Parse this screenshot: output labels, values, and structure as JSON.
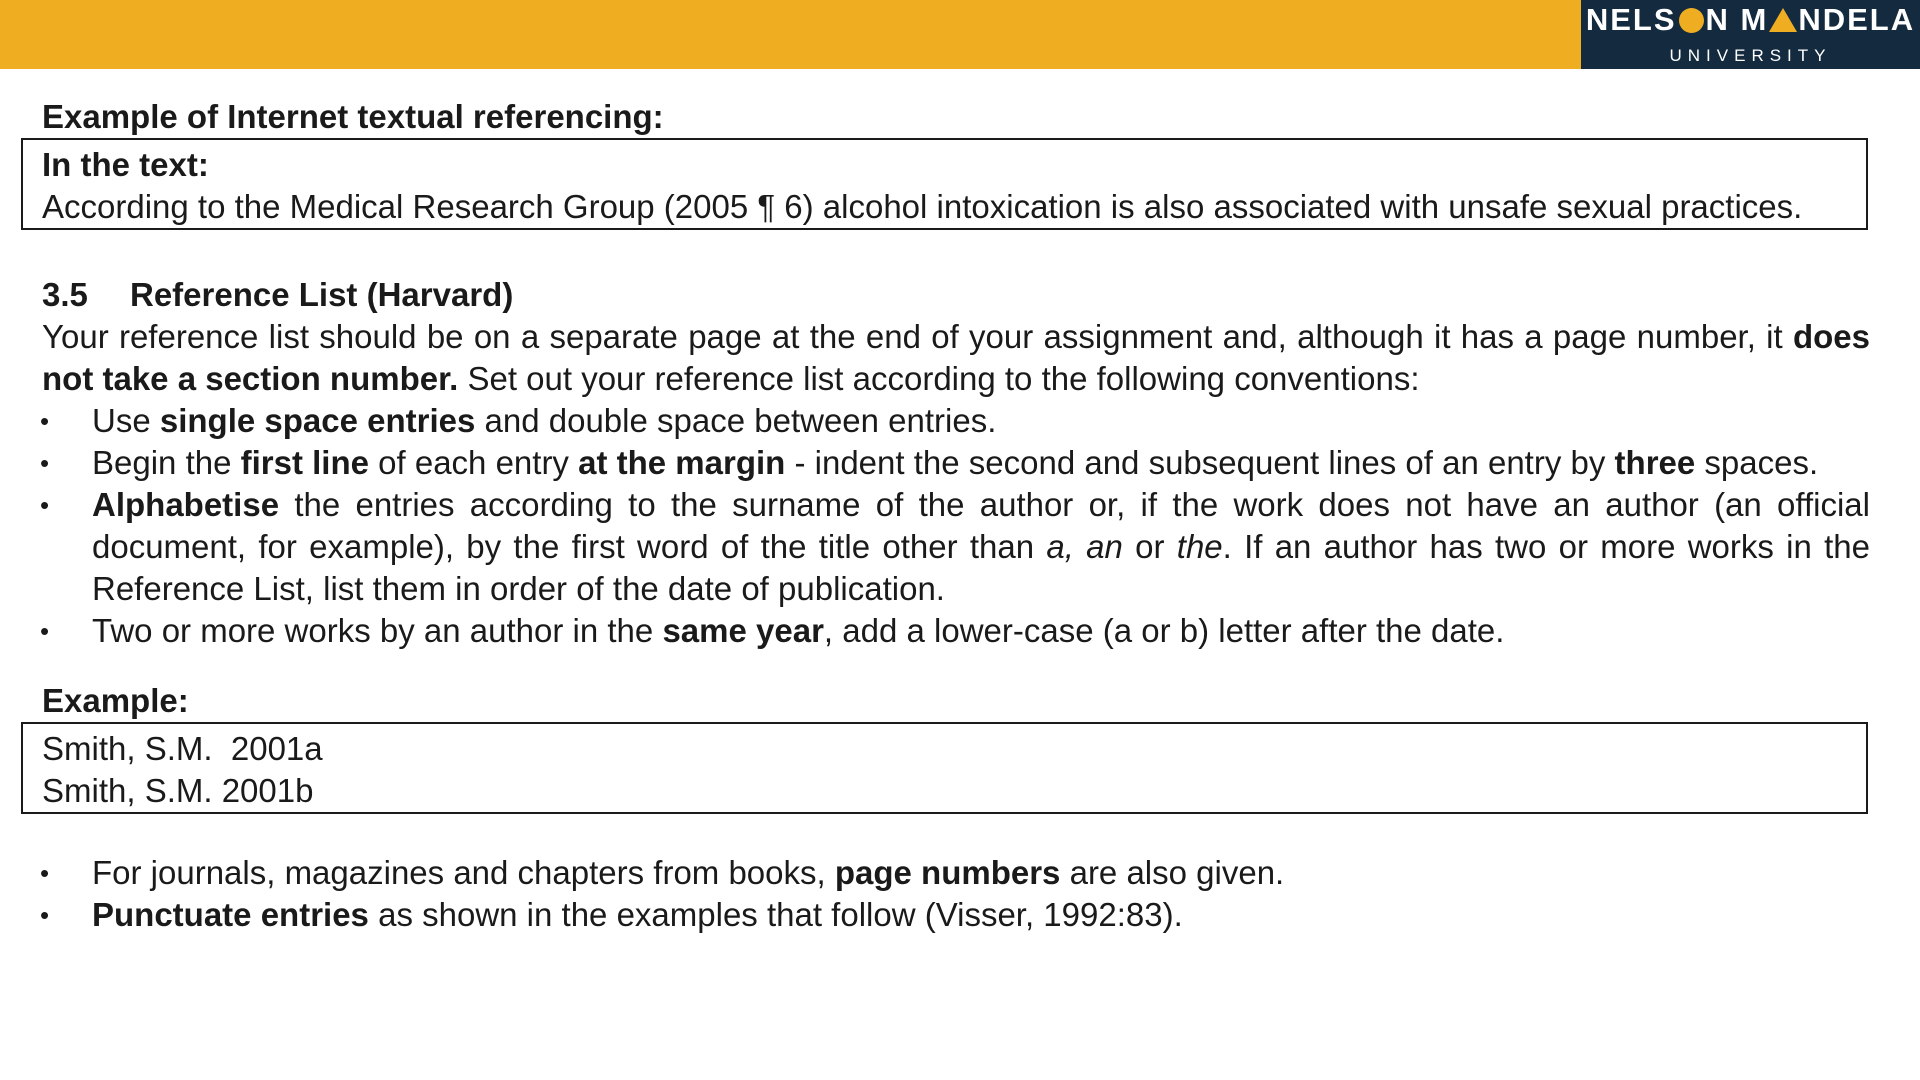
{
  "logo": {
    "name_part1": "NELS",
    "name_part2": "N  M",
    "name_part3": "NDELA",
    "subtitle": "UNIVERSITY"
  },
  "example_internet": {
    "heading": "Example of Internet textual referencing:",
    "box_label": "In the text:",
    "box_text": "According to the Medical Research Group (2005 ¶ 6) alcohol intoxication is also associated with unsafe sexual practices."
  },
  "section": {
    "number": "3.5",
    "title": "Reference List (Harvard)",
    "intro_a": "Your reference list should be on a separate page at the end of your assignment and, although it has a page number, it ",
    "intro_b": "does not take a section number.",
    "intro_c": "  Set out your reference list according to the following conventions:"
  },
  "bullets": [
    {
      "p1": "Use ",
      "b1": "single space entries",
      "p2": " and double space between entries."
    },
    {
      "p1": "Begin the ",
      "b1": "first line",
      "p2": " of each entry ",
      "b2": "at the margin",
      "p3": " - indent the second and subsequent lines of an entry by ",
      "b3": "three",
      "p4": " spaces."
    },
    {
      "b1": "Alphabetise",
      "p1": " the entries according to the surname of the author or, if the work does not have an author (an official document, for example), by the first word of the title other than ",
      "i1": "a, an",
      "p2": " or ",
      "i2": "the",
      "p3": ". If an author has two or more works in the Reference List, list them in order of the date of publication."
    },
    {
      "p1": "Two or more works by an author in the ",
      "b1": "same year",
      "p2": ", add a lower-case (a or b) letter after the date."
    }
  ],
  "example2": {
    "heading": "Example:",
    "line1": "Smith, S.M.  2001a",
    "line2": "Smith, S.M. 2001b"
  },
  "bullets2": [
    {
      "p1": "For journals, magazines and chapters from books, ",
      "b1": "page numbers",
      "p2": " are also given."
    },
    {
      "b1": "Punctuate entries",
      "p1": " as shown in the examples that follow (Visser, 1992:83)."
    }
  ],
  "bullet_char": "•"
}
